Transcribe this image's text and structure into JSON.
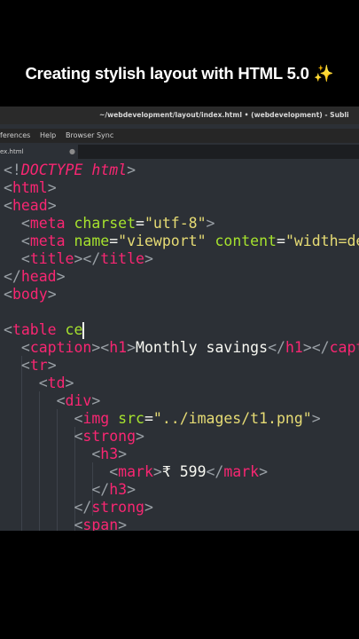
{
  "caption": {
    "text": "Creating stylish layout with HTML 5.0",
    "emoji": "✨"
  },
  "window": {
    "title": "~/webdevelopment/layout/index.html • (webdevelopment) - Subli",
    "menu": [
      "ferences",
      "Help",
      "Browser Sync"
    ],
    "tab": {
      "label": "ex.html",
      "dot": "●"
    }
  },
  "colors": {
    "bracket": "#9aa0a6",
    "tag": "#f92672",
    "attr": "#a6e22e",
    "string": "#e6db74",
    "text": "#f8f8f2",
    "doctype": "#f92672",
    "keyword": "#66d9ef"
  },
  "code": [
    {
      "spans": [
        {
          "t": "<!",
          "c": "bracket"
        },
        {
          "t": "DOCTYPE html",
          "c": "doctype",
          "i": true
        },
        {
          "t": ">",
          "c": "bracket"
        }
      ]
    },
    {
      "spans": [
        {
          "t": "<",
          "c": "bracket"
        },
        {
          "t": "html",
          "c": "tag"
        },
        {
          "t": ">",
          "c": "bracket"
        }
      ]
    },
    {
      "spans": [
        {
          "t": "<",
          "c": "bracket"
        },
        {
          "t": "head",
          "c": "tag"
        },
        {
          "t": ">",
          "c": "bracket"
        }
      ]
    },
    {
      "spans": [
        {
          "t": "  <",
          "c": "bracket"
        },
        {
          "t": "meta",
          "c": "tag"
        },
        {
          "t": " charset",
          "c": "attr"
        },
        {
          "t": "=",
          "c": "text"
        },
        {
          "t": "\"utf-8\"",
          "c": "string"
        },
        {
          "t": ">",
          "c": "bracket"
        }
      ]
    },
    {
      "spans": [
        {
          "t": "  <",
          "c": "bracket"
        },
        {
          "t": "meta",
          "c": "tag"
        },
        {
          "t": " name",
          "c": "attr"
        },
        {
          "t": "=",
          "c": "text"
        },
        {
          "t": "\"viewport\"",
          "c": "string"
        },
        {
          "t": " content",
          "c": "attr"
        },
        {
          "t": "=",
          "c": "text"
        },
        {
          "t": "\"width=de",
          "c": "string"
        }
      ]
    },
    {
      "spans": [
        {
          "t": "  <",
          "c": "bracket"
        },
        {
          "t": "title",
          "c": "tag"
        },
        {
          "t": "></",
          "c": "bracket"
        },
        {
          "t": "title",
          "c": "tag"
        },
        {
          "t": ">",
          "c": "bracket"
        }
      ]
    },
    {
      "spans": [
        {
          "t": "</",
          "c": "bracket"
        },
        {
          "t": "head",
          "c": "tag"
        },
        {
          "t": ">",
          "c": "bracket"
        }
      ]
    },
    {
      "spans": [
        {
          "t": "<",
          "c": "bracket"
        },
        {
          "t": "body",
          "c": "tag"
        },
        {
          "t": ">",
          "c": "bracket"
        }
      ]
    },
    {
      "spans": []
    },
    {
      "spans": [
        {
          "t": "<",
          "c": "bracket"
        },
        {
          "t": "table",
          "c": "tag"
        },
        {
          "t": " ce",
          "c": "attr"
        }
      ]
    },
    {
      "spans": [
        {
          "t": "  <",
          "c": "bracket"
        },
        {
          "t": "caption",
          "c": "tag"
        },
        {
          "t": "><",
          "c": "bracket"
        },
        {
          "t": "h1",
          "c": "tag"
        },
        {
          "t": ">",
          "c": "bracket"
        },
        {
          "t": "Monthly savings",
          "c": "text"
        },
        {
          "t": "</",
          "c": "bracket"
        },
        {
          "t": "h1",
          "c": "tag"
        },
        {
          "t": "></",
          "c": "bracket"
        },
        {
          "t": "capt",
          "c": "tag"
        }
      ]
    },
    {
      "spans": [
        {
          "t": "  <",
          "c": "bracket"
        },
        {
          "t": "tr",
          "c": "tag"
        },
        {
          "t": ">",
          "c": "bracket"
        }
      ]
    },
    {
      "spans": [
        {
          "t": "    <",
          "c": "bracket"
        },
        {
          "t": "td",
          "c": "tag"
        },
        {
          "t": ">",
          "c": "bracket"
        }
      ]
    },
    {
      "spans": [
        {
          "t": "      <",
          "c": "bracket"
        },
        {
          "t": "div",
          "c": "tag"
        },
        {
          "t": ">",
          "c": "bracket"
        }
      ]
    },
    {
      "spans": [
        {
          "t": "        <",
          "c": "bracket"
        },
        {
          "t": "img",
          "c": "tag"
        },
        {
          "t": " src",
          "c": "attr"
        },
        {
          "t": "=",
          "c": "text"
        },
        {
          "t": "\"../images/t1.png\"",
          "c": "string"
        },
        {
          "t": ">",
          "c": "bracket"
        }
      ]
    },
    {
      "spans": [
        {
          "t": "        <",
          "c": "bracket"
        },
        {
          "t": "strong",
          "c": "tag"
        },
        {
          "t": ">",
          "c": "bracket"
        }
      ]
    },
    {
      "spans": [
        {
          "t": "          <",
          "c": "bracket"
        },
        {
          "t": "h3",
          "c": "tag"
        },
        {
          "t": ">",
          "c": "bracket"
        }
      ]
    },
    {
      "spans": [
        {
          "t": "            <",
          "c": "bracket"
        },
        {
          "t": "mark",
          "c": "tag"
        },
        {
          "t": ">",
          "c": "bracket"
        },
        {
          "t": "₹ 599",
          "c": "text"
        },
        {
          "t": "</",
          "c": "bracket"
        },
        {
          "t": "mark",
          "c": "tag"
        },
        {
          "t": ">",
          "c": "bracket"
        }
      ]
    },
    {
      "spans": [
        {
          "t": "          </",
          "c": "bracket"
        },
        {
          "t": "h3",
          "c": "tag"
        },
        {
          "t": ">",
          "c": "bracket"
        }
      ]
    },
    {
      "spans": [
        {
          "t": "        </",
          "c": "bracket"
        },
        {
          "t": "strong",
          "c": "tag"
        },
        {
          "t": ">",
          "c": "bracket"
        }
      ]
    },
    {
      "spans": [
        {
          "t": "        <",
          "c": "bracket"
        },
        {
          "t": "span",
          "c": "tag"
        },
        {
          "t": ">",
          "c": "bracket"
        }
      ]
    }
  ]
}
